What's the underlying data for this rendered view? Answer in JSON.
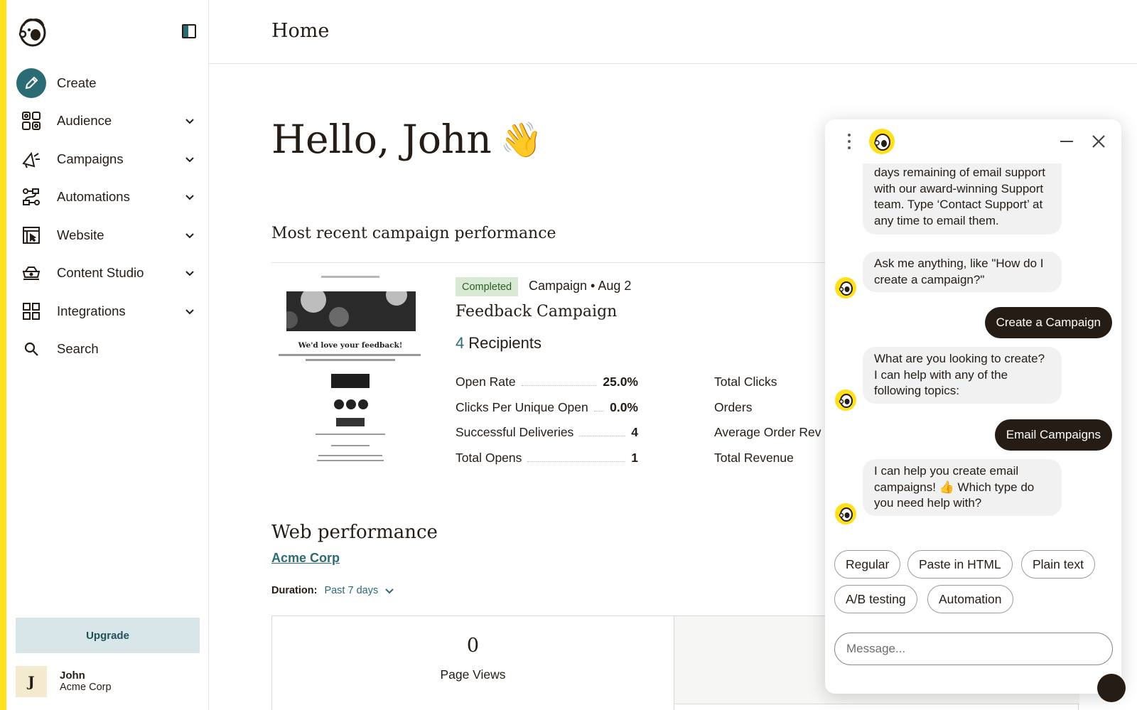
{
  "sidebar": {
    "items": [
      {
        "label": "Create",
        "icon": "pencil-icon"
      },
      {
        "label": "Audience",
        "icon": "audience-icon"
      },
      {
        "label": "Campaigns",
        "icon": "megaphone-icon"
      },
      {
        "label": "Automations",
        "icon": "automation-icon"
      },
      {
        "label": "Website",
        "icon": "website-icon"
      },
      {
        "label": "Content Studio",
        "icon": "content-studio-icon"
      },
      {
        "label": "Integrations",
        "icon": "integrations-icon"
      },
      {
        "label": "Search",
        "icon": "search-icon"
      }
    ],
    "upgrade_label": "Upgrade",
    "user": {
      "initial": "J",
      "name": "John",
      "org": "Acme Corp"
    }
  },
  "header": {
    "title": "Home"
  },
  "greeting": {
    "text": "Hello, John",
    "emoji": "👋"
  },
  "campaign_section": {
    "title": "Most recent campaign performance",
    "thumbnail_headline": "We'd love your feedback!",
    "status": "Completed",
    "meta": "Campaign • Aug 2",
    "name": "Feedback Campaign",
    "recipients_count": "4",
    "recipients_label": "Recipients",
    "stats_left": [
      {
        "label": "Open Rate",
        "value": "25.0%"
      },
      {
        "label": "Clicks Per Unique Open",
        "value": "0.0%"
      },
      {
        "label": "Successful Deliveries",
        "value": "4"
      },
      {
        "label": "Total Opens",
        "value": "1"
      }
    ],
    "stats_right": [
      {
        "label": "Total Clicks"
      },
      {
        "label": "Orders"
      },
      {
        "label": "Average Order Rev"
      },
      {
        "label": "Total Revenue"
      }
    ]
  },
  "web_section": {
    "title": "Web performance",
    "site_link": "Acme Corp",
    "duration_label": "Duration:",
    "duration_value": "Past 7 days",
    "page_views_value": "0",
    "page_views_label": "Page Views"
  },
  "chat": {
    "messages": [
      {
        "from": "bot",
        "text": "days remaining of email support with our award-winning Support team. Type ‘Contact Support’ at any time to email them."
      },
      {
        "from": "bot",
        "text": "Ask me anything, like \"How do I create a campaign?\""
      },
      {
        "from": "user",
        "text": "Create a Campaign"
      },
      {
        "from": "bot",
        "text": "What are you looking to create? I can help with any of the following topics:"
      },
      {
        "from": "user",
        "text": "Email Campaigns"
      },
      {
        "from": "bot",
        "text": "I can help you create email campaigns! 👍 Which type do you need help with?"
      }
    ],
    "chips": [
      "Regular",
      "Paste in HTML",
      "Plain text",
      "A/B testing",
      "Automation"
    ],
    "input_placeholder": "Message..."
  },
  "colors": {
    "accent_yellow": "#ffe01b",
    "brand_teal": "#2b6b74",
    "text_dark": "#241c15"
  }
}
